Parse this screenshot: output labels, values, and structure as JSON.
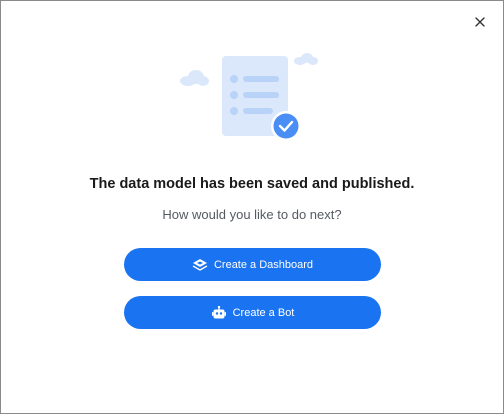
{
  "dialog": {
    "headline": "The data model has been saved and published.",
    "subhead": "How would you like to do next?",
    "close_icon": "close-icon",
    "illustration_icon": "document-checked-icon"
  },
  "actions": [
    {
      "label": "Create a Dashboard",
      "icon": "dashboard-icon"
    },
    {
      "label": "Create a Bot",
      "icon": "bot-icon"
    }
  ],
  "colors": {
    "primary": "#1a73f0",
    "illustration_light": "#dbe8fb",
    "illustration_mid": "#b9d2f7",
    "check_badge": "#4a8ef5"
  }
}
